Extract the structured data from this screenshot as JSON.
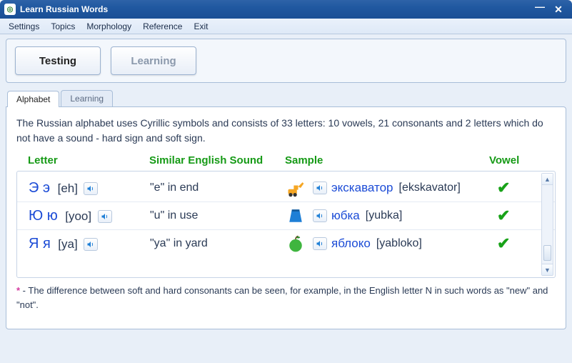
{
  "window": {
    "title": "Learn Russian Words"
  },
  "menu": [
    "Settings",
    "Topics",
    "Morphology",
    "Reference",
    "Exit"
  ],
  "toolbar": {
    "testing": "Testing",
    "learning": "Learning"
  },
  "tabs": {
    "t0": "Alphabet",
    "t1": "Learning"
  },
  "intro": "The Russian alphabet uses Cyrillic symbols and consists of 33 letters: 10 vowels, 21 consonants and 2 letters which do not have a sound - hard sign and soft sign.",
  "headers": {
    "letter": "Letter",
    "sound": "Similar English Sound",
    "sample": "Sample",
    "vowel": "Vowel"
  },
  "rows": [
    {
      "letter": "Э э",
      "phon": "[eh]",
      "sound": "\"e\" in end",
      "sampleIcon": "excavator",
      "sampleWord": "экскаватор",
      "sampleTr": "[ekskavator]",
      "vowel": true
    },
    {
      "letter": "Ю ю",
      "phon": "[yoo]",
      "sound": "\"u\" in use",
      "sampleIcon": "skirt",
      "sampleWord": "юбка",
      "sampleTr": "[yubka]",
      "vowel": true
    },
    {
      "letter": "Я я",
      "phon": "[ya]",
      "sound": "\"ya\" in yard",
      "sampleIcon": "apple",
      "sampleWord": "яблоко",
      "sampleTr": "[yabloko]",
      "vowel": true
    }
  ],
  "noteStar": "*",
  "note": " - The difference between soft and hard consonants can be seen, for example, in the English letter N in such words as \"new\" and \"not\"."
}
